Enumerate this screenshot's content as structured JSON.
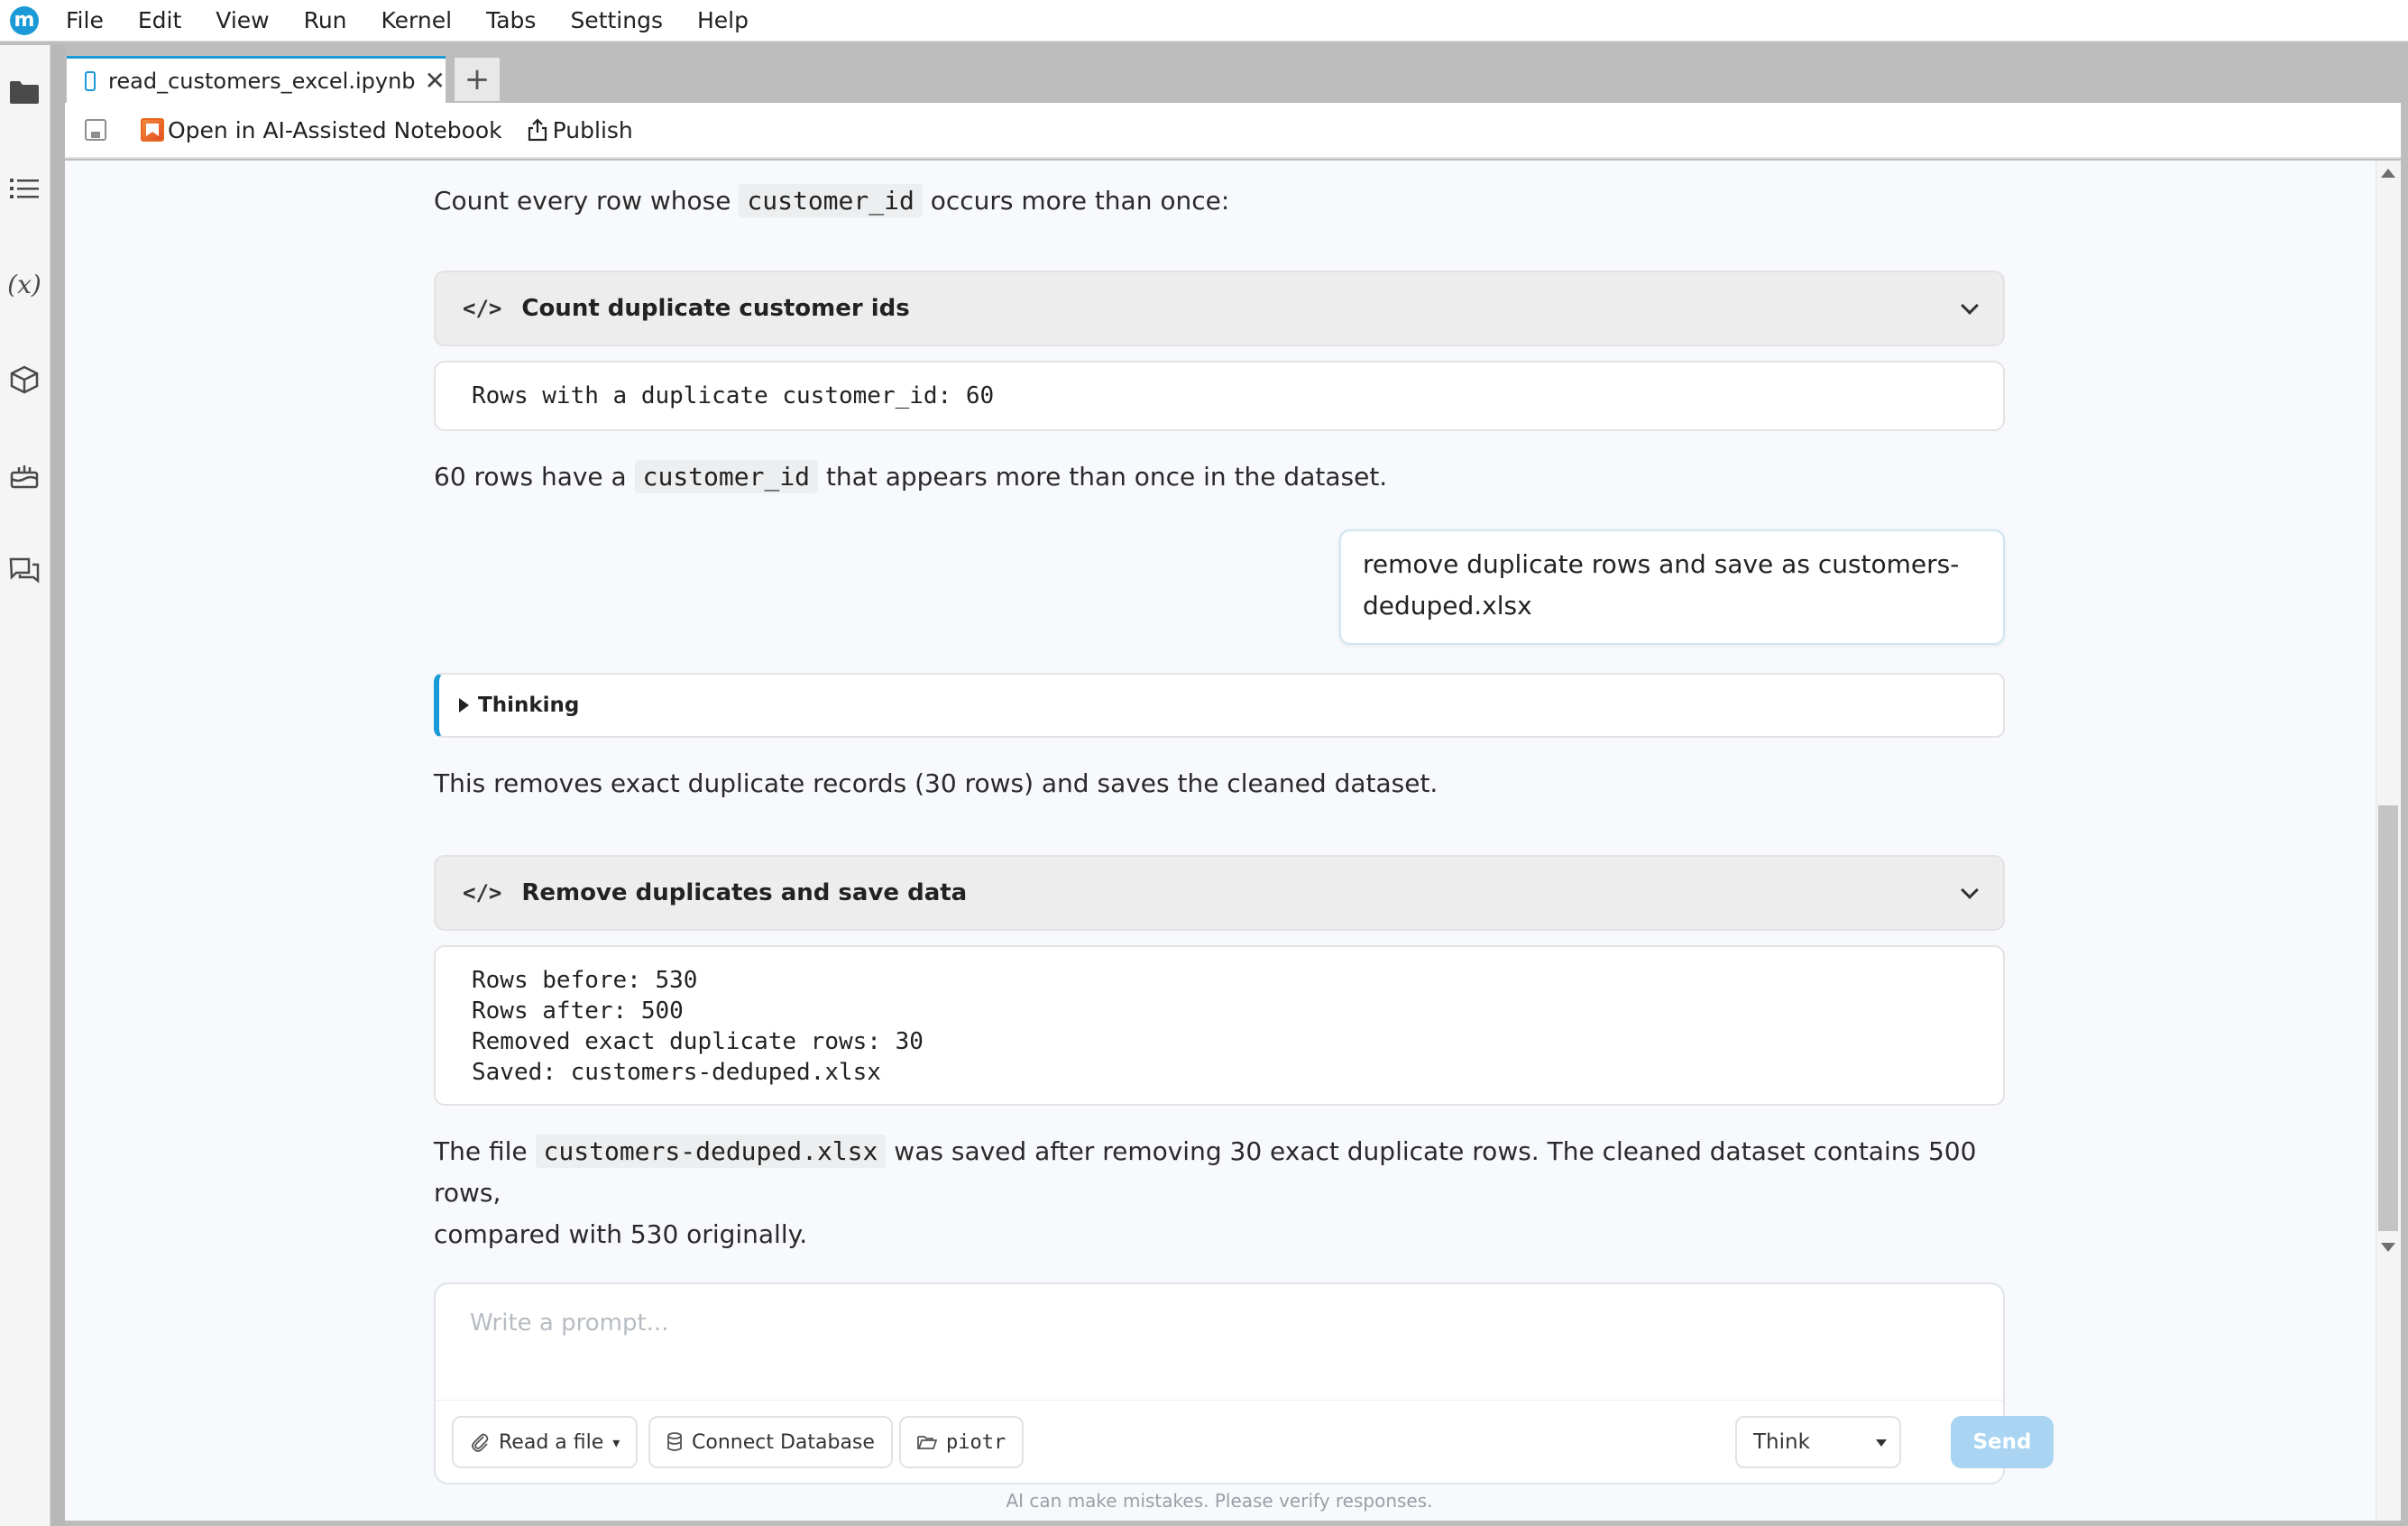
{
  "menubar": {
    "logo_letter": "m",
    "items": [
      "File",
      "Edit",
      "View",
      "Run",
      "Kernel",
      "Tabs",
      "Settings",
      "Help"
    ]
  },
  "tab": {
    "filename": "read_customers_excel.ipynb",
    "close_glyph": "✕",
    "add_glyph": "+"
  },
  "toolbar": {
    "open_ai_label": "Open in AI-Assisted Notebook",
    "publish_label": "Publish"
  },
  "notebook": {
    "intro": {
      "before": "Count every row whose ",
      "code": "customer_id",
      "after": " occurs more than once:"
    },
    "cell1": {
      "icon": "</>",
      "title": "Count duplicate customer ids",
      "output": [
        "Rows with a duplicate customer_id: 60"
      ]
    },
    "summary1": {
      "before": "60 rows have a ",
      "code": "customer_id",
      "after": " that appears more than once in the dataset."
    },
    "user_message": "remove duplicate rows and save as customers-deduped.xlsx",
    "thinking_label": "Thinking",
    "explain": "This removes exact duplicate records (30 rows) and saves the cleaned dataset.",
    "cell2": {
      "icon": "</>",
      "title": "Remove duplicates and save data",
      "output": [
        "Rows before: 530",
        "Rows after: 500",
        "Removed exact duplicate rows: 30",
        "Saved: customers-deduped.xlsx"
      ]
    },
    "summary2": {
      "before": "The file ",
      "code": "customers-deduped.xlsx",
      "after_line1": " was saved after removing 30 exact duplicate rows. The cleaned dataset contains 500 rows,",
      "line2": "compared with 530 originally."
    }
  },
  "composer": {
    "placeholder": "Write a prompt...",
    "read_file_label": "Read a file",
    "read_file_caret": "▾",
    "connect_db_label": "Connect Database",
    "folder_label": "piotr",
    "mode_value": "Think",
    "send_label": "Send",
    "disclaimer": "AI can make mistakes. Please verify responses."
  },
  "icons": {
    "rail": [
      "folder-icon",
      "list-icon",
      "variable-icon",
      "package-icon",
      "cake-icon",
      "chat-icon"
    ],
    "variable_glyph": "(x)"
  },
  "colors": {
    "accent": "#1a9ad6",
    "send_disabled": "#a9d5f2",
    "ai_orange": "#e8661f"
  }
}
